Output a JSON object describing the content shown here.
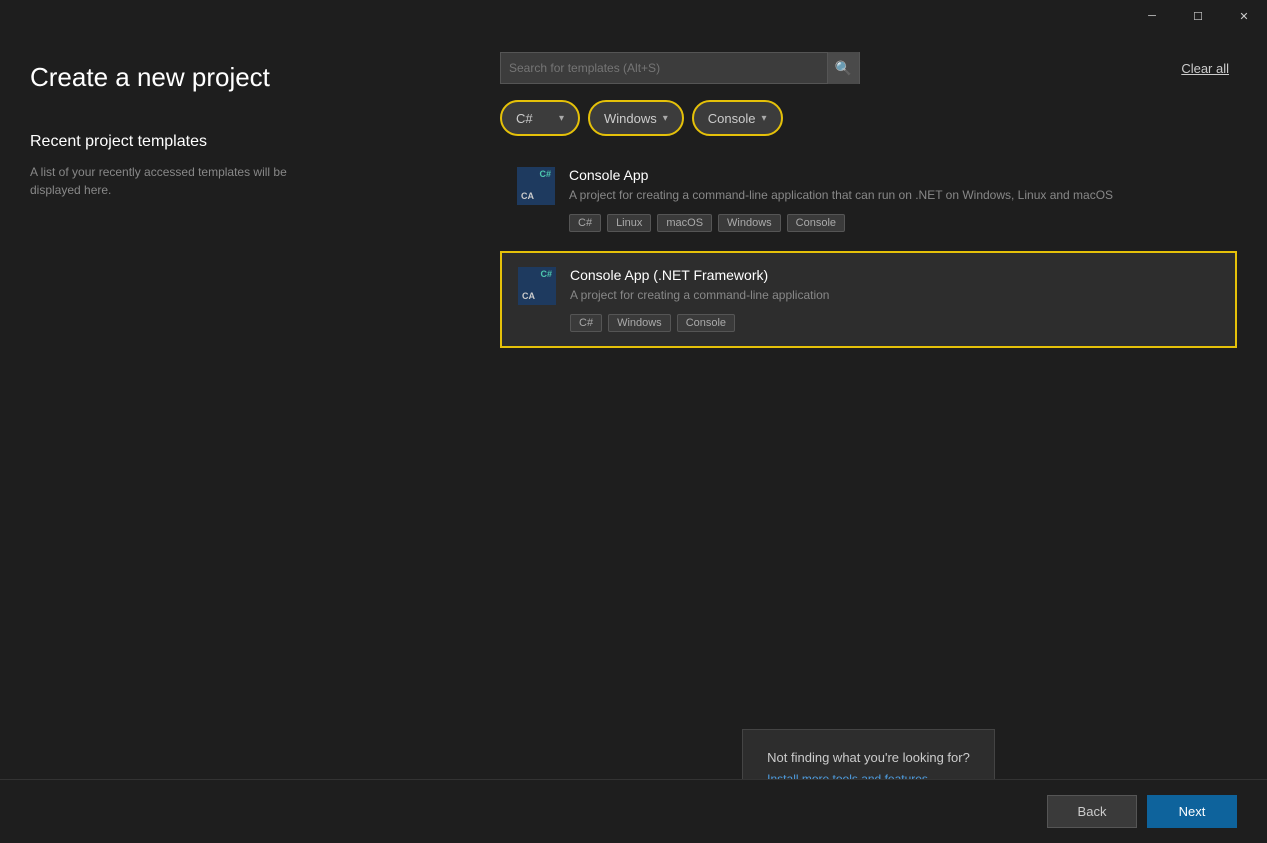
{
  "titlebar": {
    "minimize_label": "─",
    "maximize_label": "☐",
    "close_label": "✕"
  },
  "page": {
    "title": "Create a new project",
    "recent_title": "Recent project templates",
    "recent_desc": "A list of your recently accessed templates will be displayed here."
  },
  "search": {
    "placeholder": "Search for templates (Alt+S)",
    "icon": "🔍"
  },
  "clear_all": "Clear all",
  "filters": [
    {
      "label": "C#",
      "type": "highlighted"
    },
    {
      "label": "Windows",
      "type": "highlighted"
    },
    {
      "label": "Console",
      "type": "highlighted"
    }
  ],
  "templates": [
    {
      "name": "Console App",
      "desc": "A project for creating a command-line application that can run on .NET on Windows, Linux and macOS",
      "tags": [
        "C#",
        "Linux",
        "macOS",
        "Windows",
        "Console"
      ],
      "selected": false
    },
    {
      "name": "Console App (.NET Framework)",
      "desc": "A project for creating a command-line application",
      "tags": [
        "C#",
        "Windows",
        "Console"
      ],
      "selected": true
    }
  ],
  "not_finding": {
    "title": "Not finding what you're looking for?",
    "link": "Install more tools and features"
  },
  "buttons": {
    "back": "Back",
    "next": "Next"
  }
}
